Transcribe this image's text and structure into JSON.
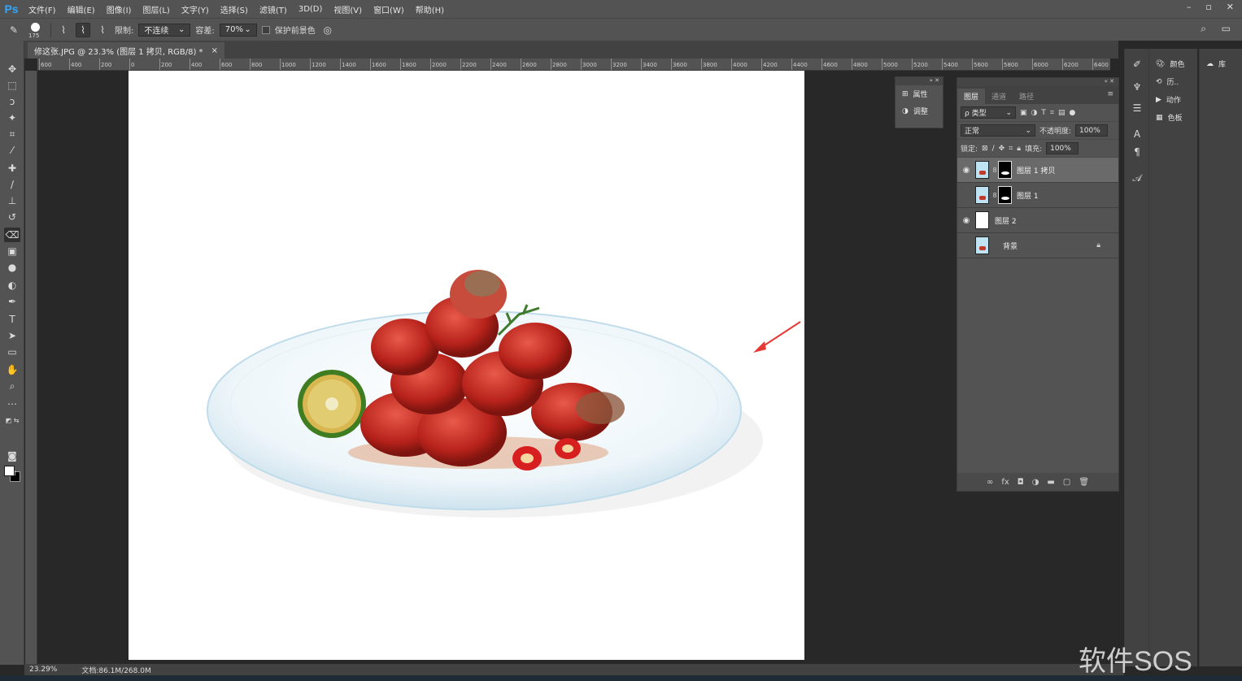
{
  "app": {
    "logo": "Ps"
  },
  "menu": [
    "文件(F)",
    "编辑(E)",
    "图像(I)",
    "图层(L)",
    "文字(Y)",
    "选择(S)",
    "滤镜(T)",
    "3D(D)",
    "视图(V)",
    "窗口(W)",
    "帮助(H)"
  ],
  "window_controls": {
    "minimize": "–",
    "restore": "▫",
    "close": "✕"
  },
  "options": {
    "brush_size": "175",
    "limit_label": "限制:",
    "limit_value": "不连续",
    "tolerance_label": "容差:",
    "tolerance_value": "70%",
    "protect_label": "保护前景色"
  },
  "document": {
    "tab_title": "修这张.JPG @ 23.3% (图层 1 拷贝, RGB/8) *",
    "tab_close": "×"
  },
  "ruler_h": [
    "600",
    "400",
    "200",
    "0",
    "200",
    "400",
    "600",
    "800",
    "1000",
    "1200",
    "1400",
    "1600",
    "1800",
    "2000",
    "2200",
    "2400",
    "2600",
    "2800",
    "3000",
    "3200",
    "3400",
    "3600",
    "3800",
    "4000",
    "4200",
    "4400",
    "4600",
    "4800",
    "5000",
    "5200",
    "5400",
    "5600",
    "5800",
    "6000",
    "6200",
    "6400"
  ],
  "mini_panel": {
    "properties": "属性",
    "adjustments": "调整"
  },
  "layers_panel": {
    "tabs": [
      "图层",
      "通道",
      "路径"
    ],
    "filter_label": "ρ 类型",
    "blend_mode": "正常",
    "opacity_label": "不透明度:",
    "opacity_value": "100%",
    "lock_label": "锁定:",
    "fill_label": "填充:",
    "fill_value": "100%",
    "layers": [
      {
        "name": "图层 1 拷贝",
        "visible": true,
        "selected": true,
        "has_mask": true
      },
      {
        "name": "图层 1",
        "visible": false,
        "selected": false,
        "has_mask": true
      },
      {
        "name": "图层 2",
        "visible": true,
        "selected": false,
        "has_mask": false
      },
      {
        "name": "背景",
        "visible": false,
        "selected": false,
        "has_mask": false,
        "locked": true
      }
    ]
  },
  "right_dock": {
    "color": "颜色",
    "history": "历..",
    "actions": "动作",
    "swatches": "色板",
    "libraries": "库"
  },
  "status": {
    "zoom": "23.29%",
    "doc_size": "文档:86.1M/268.0M"
  },
  "watermark": "软件SOS",
  "colors": {
    "accent": "#31a8ff",
    "arrow": "#e53935"
  }
}
